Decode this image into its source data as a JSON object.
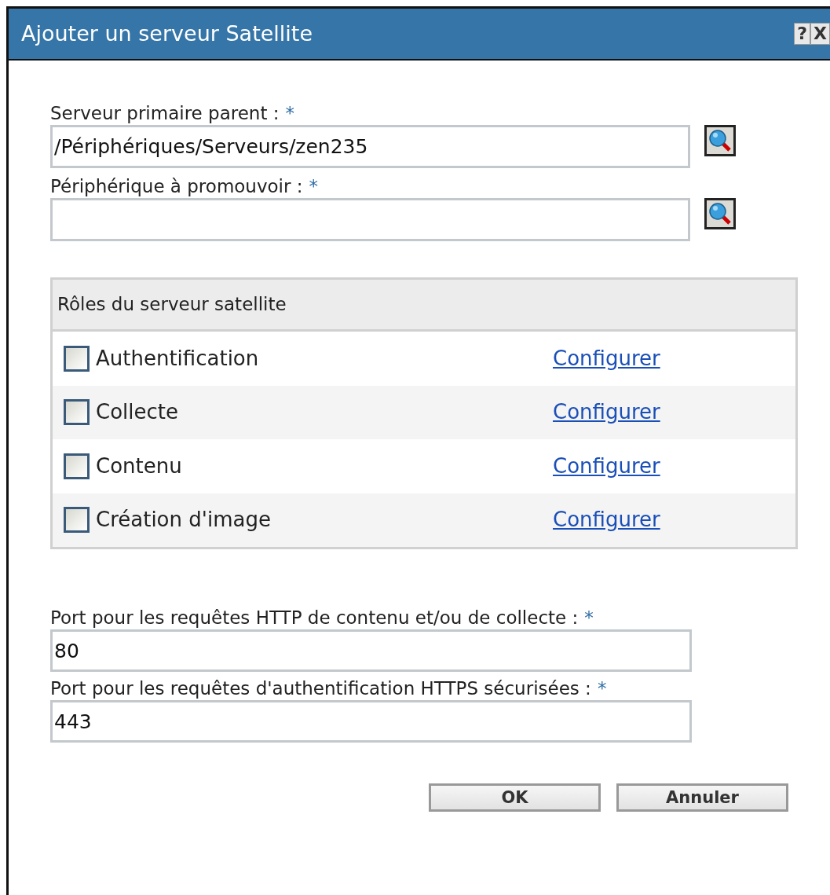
{
  "window": {
    "title": "Ajouter un serveur Satellite",
    "title_buttons": [
      "?",
      "X"
    ]
  },
  "fields": [
    {
      "label": "Serveur primaire parent :",
      "required_mark": "*",
      "value": "/Périphériques/Serveurs/zen235"
    },
    {
      "label": "Périphérique à promouvoir :",
      "required_mark": "*"
    }
  ],
  "roles": {
    "title": "Rôles du serveur satellite",
    "items": [
      {
        "label": "Authentification",
        "checked": false,
        "link": "Configurer"
      },
      {
        "label": "Collecte",
        "checked": false,
        "link": "Configurer"
      },
      {
        "label": "Contenu",
        "checked": false,
        "link": "Configurer"
      },
      {
        "label": "Création d'image",
        "checked": false,
        "link": "Configurer"
      }
    ]
  },
  "ports": [
    {
      "label": "Port pour les requêtes HTTP de contenu et/ou de collecte :",
      "required_mark": "*",
      "value": "80"
    },
    {
      "label": "Port pour les requêtes d'authentification HTTPS sécurisées :",
      "required_mark": "*",
      "value": "443"
    }
  ],
  "buttons": [
    "OK",
    "Annuler"
  ]
}
